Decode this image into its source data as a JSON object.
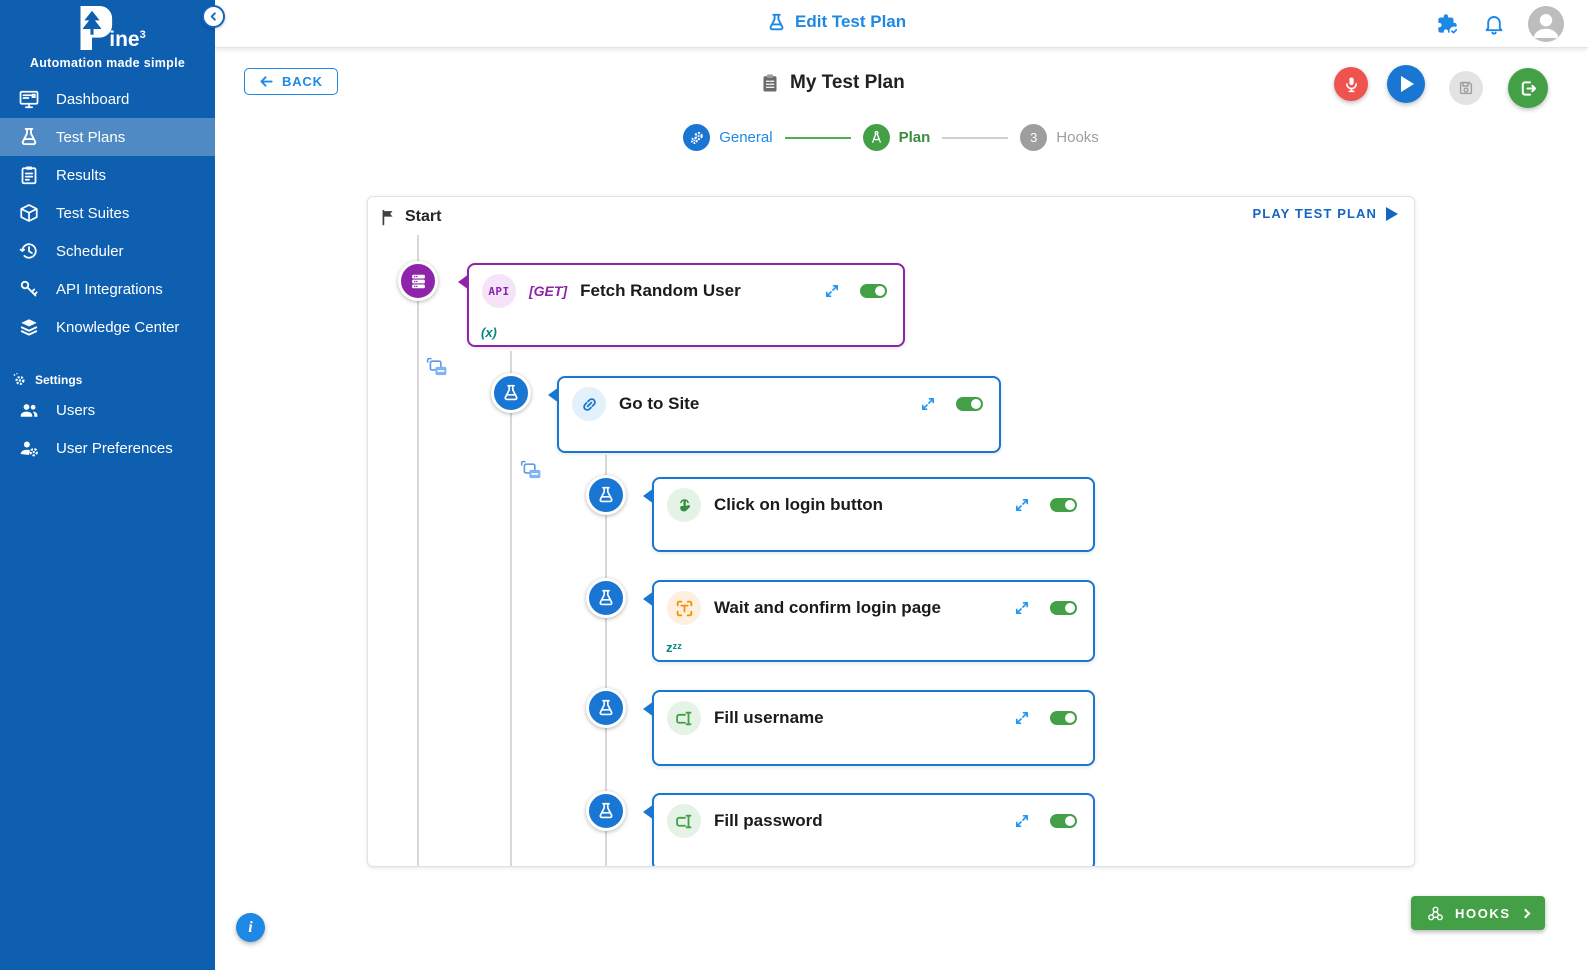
{
  "brand": {
    "logo_text": "ine",
    "logo_sup": "3",
    "tagline": "Automation made simple",
    "logo_icon": "pine-tree-logo-icon"
  },
  "sidebar": {
    "items": [
      {
        "label": "Dashboard",
        "icon": "dashboard-icon"
      },
      {
        "label": "Test Plans",
        "icon": "flask-icon",
        "active": true
      },
      {
        "label": "Results",
        "icon": "results-clipboard-icon"
      },
      {
        "label": "Test Suites",
        "icon": "cube-icon"
      },
      {
        "label": "Scheduler",
        "icon": "history-clock-icon"
      },
      {
        "label": "API Integrations",
        "icon": "keys-icon"
      },
      {
        "label": "Knowledge Center",
        "icon": "layers-icon"
      }
    ],
    "settings_header": "Settings",
    "settings_icon": "gear-icon",
    "settings_items": [
      {
        "label": "Users",
        "icon": "users-icon"
      },
      {
        "label": "User Preferences",
        "icon": "user-gear-icon"
      }
    ]
  },
  "header": {
    "title": "Edit Test Plan",
    "title_icon": "flask-icon",
    "right_icons": [
      "puzzle-check-icon",
      "bell-icon",
      "avatar"
    ]
  },
  "toolbar": {
    "back_label": "BACK",
    "title": "My Test Plan",
    "title_icon": "clipboard-icon",
    "buttons": [
      "microphone-button",
      "play-button",
      "save-button-disabled",
      "save-exit-button"
    ]
  },
  "stepper": {
    "steps": [
      {
        "label": "General",
        "icon": "gears-icon",
        "state": "done",
        "color": "#1976D2"
      },
      {
        "label": "Plan",
        "icon": "compass-icon",
        "state": "current",
        "color": "#43A047"
      },
      {
        "label": "Hooks",
        "number": "3",
        "state": "pending",
        "color": "#9E9E9E"
      }
    ]
  },
  "canvas": {
    "start_label": "Start",
    "play_label": "PLAY TEST PLAN",
    "nodes": [
      {
        "badge": "API",
        "method": "[GET]",
        "title": "Fetch Random User",
        "note": "(x)",
        "icon": "api-server-icon",
        "accent": "#8E24AA",
        "enabled": true
      },
      {
        "title": "Go to Site",
        "icon": "link-icon",
        "accent": "#1976D2",
        "enabled": true
      },
      {
        "title": "Click on login button",
        "icon": "tap-icon",
        "accent": "#1976D2",
        "enabled": true
      },
      {
        "title": "Wait and confirm login page",
        "note": "zᶻᶻ",
        "icon": "text-scan-icon",
        "accent": "#1976D2",
        "enabled": true
      },
      {
        "title": "Fill username",
        "icon": "input-field-icon",
        "accent": "#1976D2",
        "enabled": true
      },
      {
        "title": "Fill password",
        "icon": "input-field-icon",
        "accent": "#1976D2",
        "enabled": true
      }
    ]
  },
  "footer": {
    "hooks_label": "HOOKS",
    "hooks_icon": "webhook-icon",
    "info_label": "i"
  },
  "colors": {
    "sidebar_blue": "#0E5FB0",
    "primary_blue": "#1976D2",
    "link_blue": "#1E88E5",
    "purple": "#8E24AA",
    "green": "#43A047",
    "red": "#EF5350",
    "teal_note": "#00897B",
    "gray": "#9E9E9E"
  }
}
